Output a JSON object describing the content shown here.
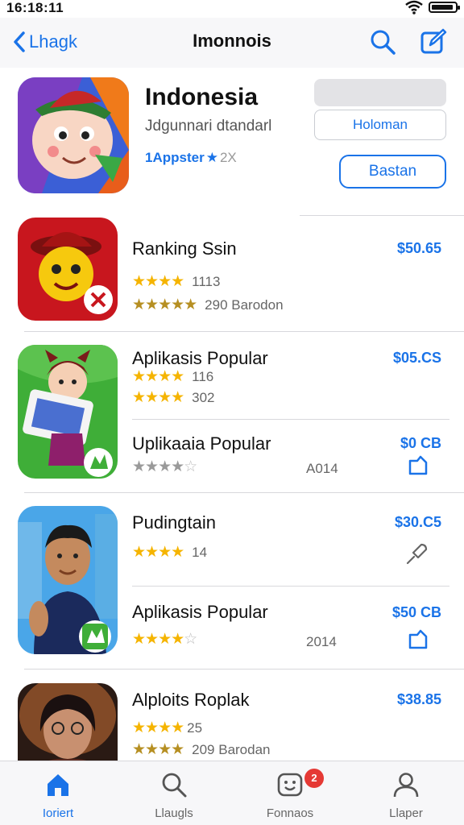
{
  "status": {
    "time": "16:18:11"
  },
  "nav": {
    "back_label": "Lhagk",
    "title": "Imonnois"
  },
  "featured": {
    "title": "Indonesia",
    "subtitle": "Jdgunnari dtandarl",
    "meta_label": "1Appster",
    "meta_extra": "2X",
    "secondary_button": "Holoman",
    "primary_button": "Bastan"
  },
  "apps": [
    {
      "title": "Ranking Ssin",
      "price": "$50.65",
      "rating_count": "1113",
      "sub_text": "290 Barodon"
    },
    {
      "title": "Aplikasis Popular",
      "price": "$05.CS",
      "rating_count": "116",
      "sub_text": "302"
    },
    {
      "title": "Uplikaaia Popular",
      "price": "$0 CB",
      "year": "A014"
    },
    {
      "title": "Pudingtain",
      "price": "$30.C5",
      "rating_count": "14"
    },
    {
      "title": "Aplikasis Popular",
      "price": "$50 CB",
      "year": "2014"
    },
    {
      "title": "Alploits Roplak",
      "price": "$38.85",
      "rating_count": "25",
      "sub_text": "209 Barodan"
    }
  ],
  "tabs": [
    {
      "label": "Ioriert"
    },
    {
      "label": "Llaugls"
    },
    {
      "label": "Fonnaos"
    },
    {
      "label": "Llaper"
    }
  ],
  "badge_count": "2",
  "colors": {
    "accent": "#1a73e8",
    "star": "#f5b400",
    "badge": "#e53935"
  }
}
